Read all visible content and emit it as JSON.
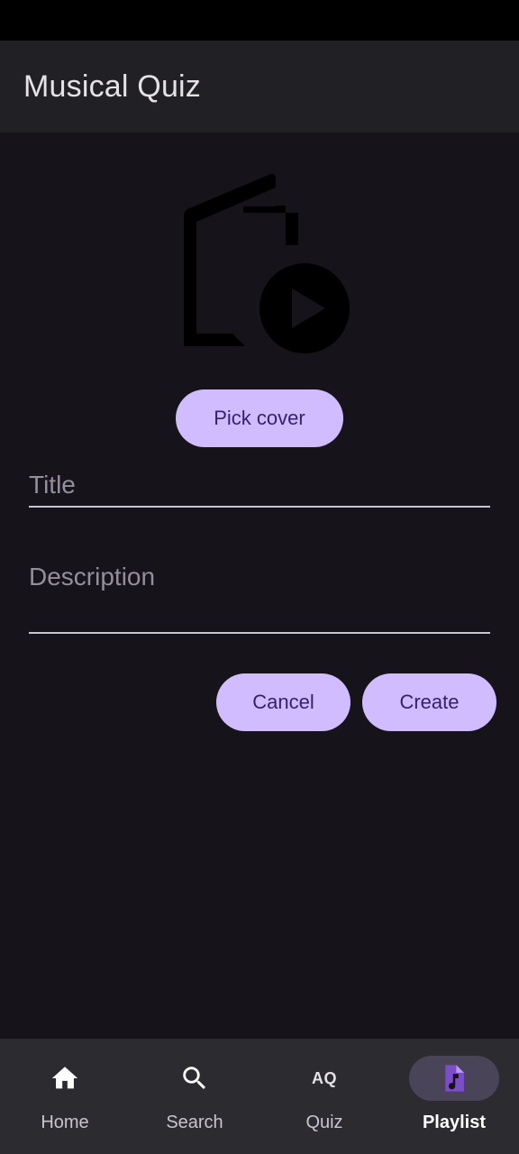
{
  "app": {
    "title": "Musical Quiz"
  },
  "cover": {
    "icon": "playlist-cover-placeholder-icon",
    "pick_label": "Pick cover"
  },
  "form": {
    "title_placeholder": "Title",
    "title_value": "",
    "description_placeholder": "Description",
    "description_value": ""
  },
  "actions": {
    "cancel_label": "Cancel",
    "create_label": "Create"
  },
  "nav": {
    "items": [
      {
        "label": "Home",
        "icon": "home-icon",
        "active": false
      },
      {
        "label": "Search",
        "icon": "search-icon",
        "active": false
      },
      {
        "label": "Quiz",
        "icon": "quiz-icon",
        "icon_text": "AQ",
        "active": false
      },
      {
        "label": "Playlist",
        "icon": "playlist-file-music-icon",
        "active": true
      }
    ]
  },
  "colors": {
    "background": "#16131b",
    "app_bar": "#212025",
    "accent": "#d0bcff",
    "on_accent": "#381e72",
    "nav_bar": "#2c2b30",
    "nav_active_indicator": "#4a4458",
    "playlist_icon": "#7b4dc8"
  }
}
